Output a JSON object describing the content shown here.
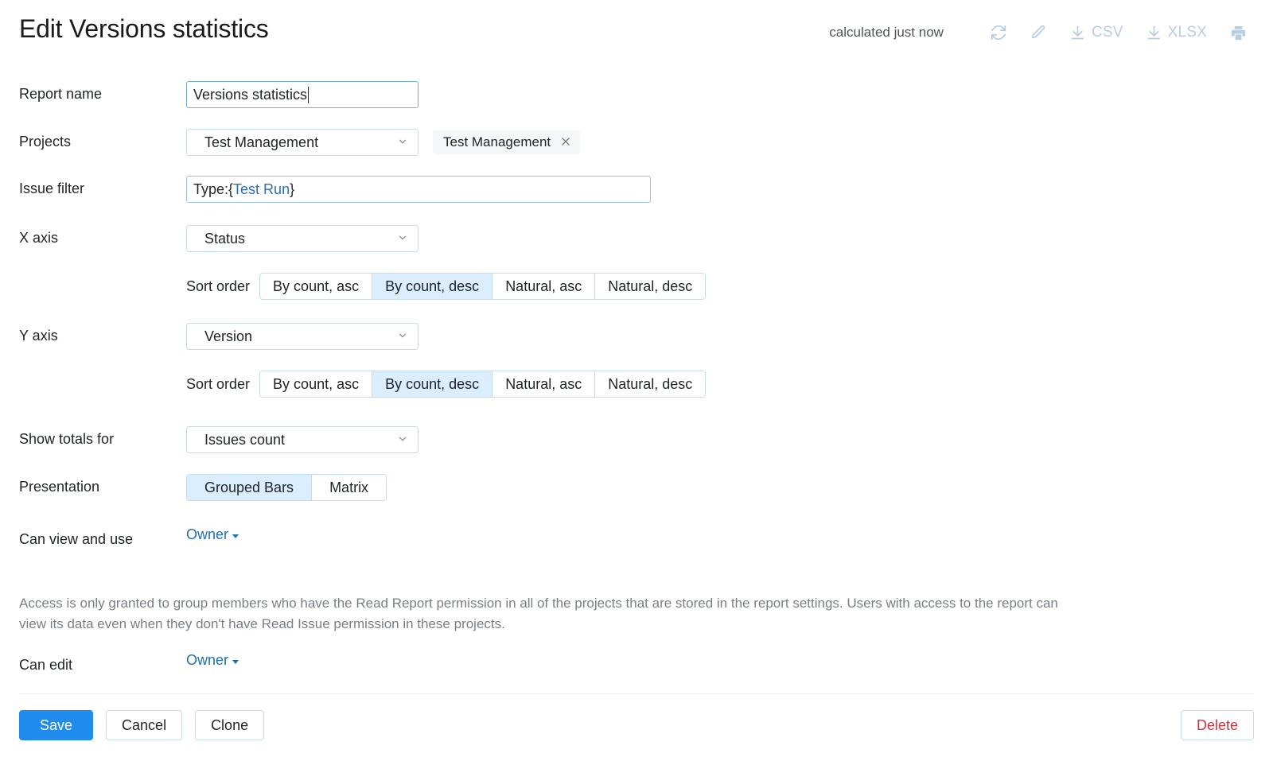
{
  "header": {
    "title": "Edit Versions statistics",
    "calculated": "calculated just now",
    "actions": [
      {
        "name": "refresh",
        "icon": "refresh-icon",
        "label": ""
      },
      {
        "name": "edit",
        "icon": "pencil-icon",
        "label": ""
      },
      {
        "name": "export-csv",
        "icon": "download-icon",
        "label": "CSV"
      },
      {
        "name": "export-xlsx",
        "icon": "download-icon",
        "label": "XLSX"
      },
      {
        "name": "print",
        "icon": "printer-icon",
        "label": ""
      }
    ]
  },
  "form": {
    "report_name": {
      "label": "Report name",
      "value": "Versions statistics",
      "placeholder": "Report name"
    },
    "projects": {
      "label": "Projects",
      "selected": "Test Management",
      "chips": [
        "Test Management"
      ]
    },
    "issue_filter": {
      "label": "Issue filter",
      "prefix": "Type: ",
      "brace_open": "{",
      "token": "Test Run",
      "brace_close": "}",
      "placeholder": "Issue filter"
    },
    "x_axis": {
      "label": "X axis",
      "value": "Status",
      "sort_label": "Sort order",
      "sort_options": [
        "By count, asc",
        "By count, desc",
        "Natural, asc",
        "Natural, desc"
      ],
      "sort_selected": "By count, desc"
    },
    "y_axis": {
      "label": "Y axis",
      "value": "Version",
      "sort_label": "Sort order",
      "sort_options": [
        "By count, asc",
        "By count, desc",
        "Natural, asc",
        "Natural, desc"
      ],
      "sort_selected": "By count, desc"
    },
    "totals": {
      "label": "Show totals for",
      "value": "Issues count"
    },
    "presentation": {
      "label": "Presentation",
      "options": [
        "Grouped Bars",
        "Matrix"
      ],
      "selected": "Grouped Bars"
    },
    "can_view": {
      "label": "Can view and use",
      "value": "Owner"
    },
    "access_note": "Access is only granted to group members who have the Read Report permission in all of the projects that are stored in the report settings. Users with access to the report can view its data even when they don't have Read Issue permission in these projects.",
    "can_edit": {
      "label": "Can edit",
      "value": "Owner"
    }
  },
  "footer": {
    "save": "Save",
    "cancel": "Cancel",
    "clone": "Clone",
    "delete": "Delete"
  },
  "colors": {
    "accent": "#1f8ced",
    "selected_segment": "#daeeff",
    "link": "#1f6fb2",
    "danger": "#cc3340",
    "muted": "#797f85",
    "toolbar_icon": "#b8cde2"
  }
}
